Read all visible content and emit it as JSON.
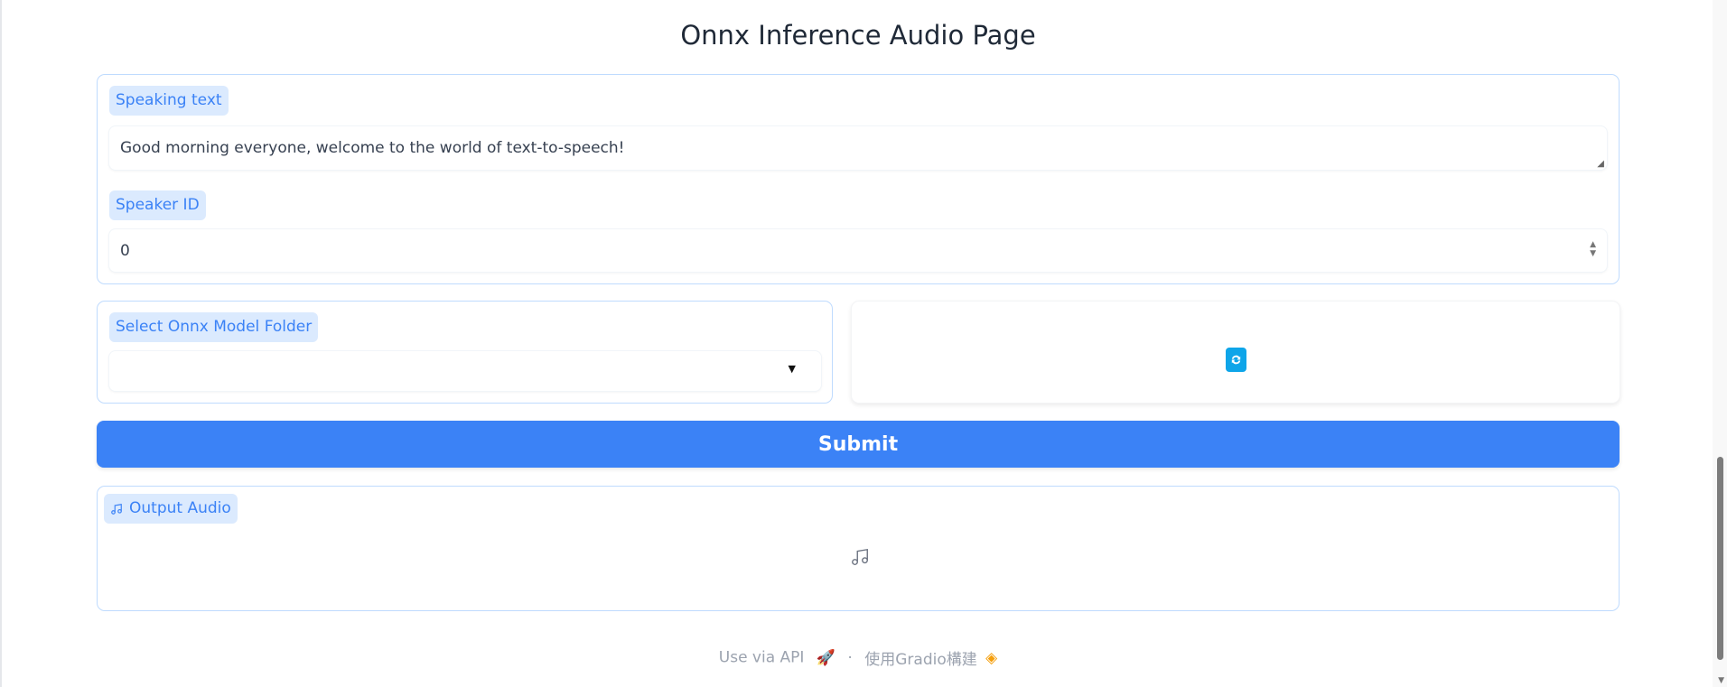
{
  "page": {
    "title": "Onnx Inference Audio Page"
  },
  "speaking_text": {
    "label": "Speaking text",
    "value": "Good morning everyone, welcome to the world of text-to-speech!"
  },
  "speaker_id": {
    "label": "Speaker ID",
    "value": "0"
  },
  "model_folder": {
    "label": "Select Onnx Model Folder",
    "value": ""
  },
  "submit": {
    "label": "Submit"
  },
  "output_audio": {
    "label": "Output Audio"
  },
  "footer": {
    "api": "Use via API",
    "separator": "·",
    "built_with": "使用Gradio構建"
  },
  "colors": {
    "accent": "#3b82f6",
    "label_bg": "#dbeafe",
    "refresh": "#0ea5e9"
  }
}
